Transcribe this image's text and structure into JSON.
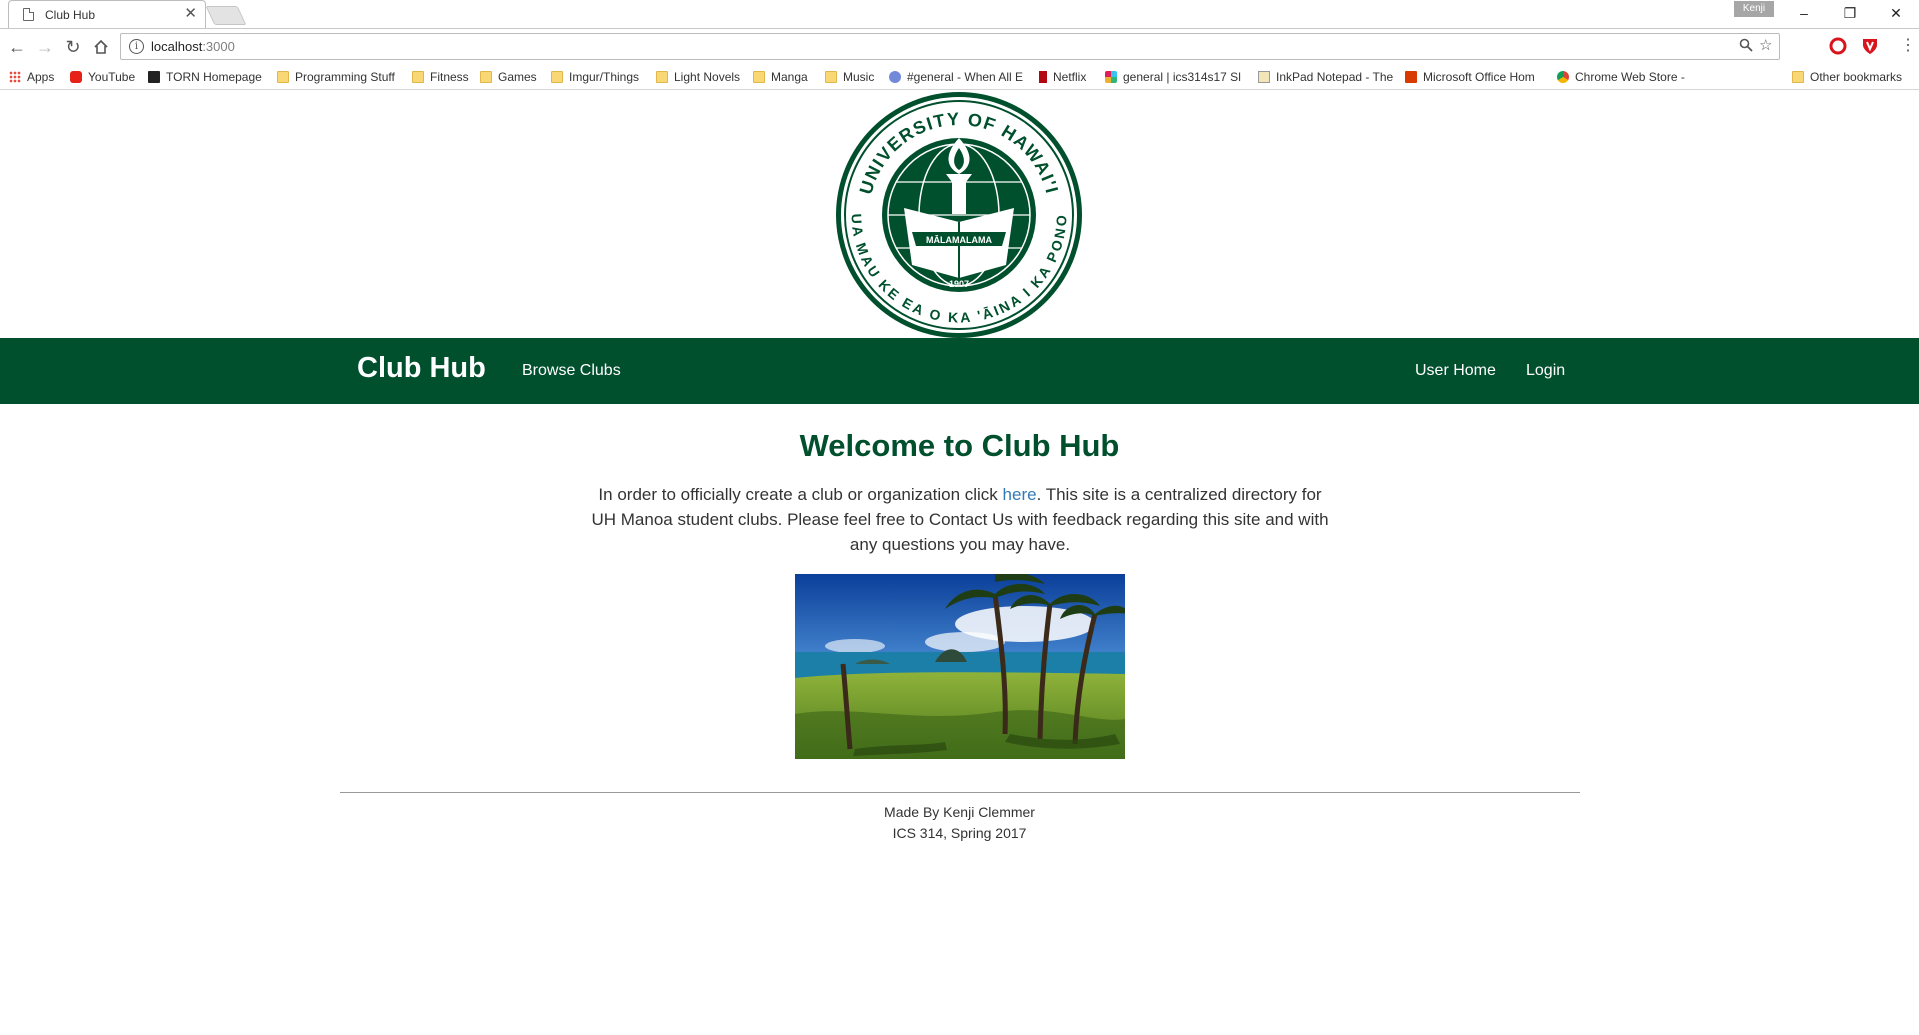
{
  "browser": {
    "tab_title": "Club Hub",
    "tab_close": "✕",
    "profile_name": "Kenji",
    "url_host": "localhost",
    "url_port": ":3000",
    "window_controls": {
      "minimize": "–",
      "restore": "❐",
      "close": "✕"
    },
    "bookmarks": [
      {
        "label": "Apps",
        "icon": "apps-grid-icon"
      },
      {
        "label": "YouTube",
        "icon": "youtube-icon"
      },
      {
        "label": "TORN Homepage",
        "icon": "torn-icon"
      },
      {
        "label": "Programming Stuff",
        "icon": "folder-icon"
      },
      {
        "label": "Fitness",
        "icon": "folder-icon"
      },
      {
        "label": "Games",
        "icon": "folder-icon"
      },
      {
        "label": "Imgur/Things",
        "icon": "folder-icon"
      },
      {
        "label": "Light Novels",
        "icon": "folder-icon"
      },
      {
        "label": "Manga",
        "icon": "folder-icon"
      },
      {
        "label": "Music",
        "icon": "folder-icon"
      },
      {
        "label": "#general - When All E",
        "icon": "discord-icon"
      },
      {
        "label": "Netflix",
        "icon": "netflix-icon"
      },
      {
        "label": "general | ics314s17 Sl",
        "icon": "slack-icon"
      },
      {
        "label": "InkPad Notepad - The",
        "icon": "inkpad-icon"
      },
      {
        "label": "Microsoft Office Hom",
        "icon": "office-icon"
      },
      {
        "label": "Chrome Web Store - ",
        "icon": "chrome-store-icon"
      }
    ],
    "other_bookmarks": "Other bookmarks"
  },
  "seal": {
    "top_text": "UNIVERSITY OF HAWAI'I",
    "bottom_text": "UA MAU KE EA O KA 'ĀINA I KA PONO",
    "banner_text": "MĀLAMALAMA",
    "year": "1907"
  },
  "navbar": {
    "brand": "Club Hub",
    "browse": "Browse Clubs",
    "user_home": "User Home",
    "login": "Login"
  },
  "main": {
    "title": "Welcome to Club Hub",
    "intro_before": "In order to officially create a club or organization click ",
    "intro_link": "here",
    "intro_after": ". This site is a centralized directory for UH Manoa student clubs. Please feel free to Contact Us with feedback regarding this site and with any questions you may have."
  },
  "footer": {
    "line1": "Made By Kenji Clemmer",
    "line2": "ICS 314, Spring 2017"
  },
  "colors": {
    "brand_green": "#004f2d",
    "link_blue": "#337ab7"
  }
}
